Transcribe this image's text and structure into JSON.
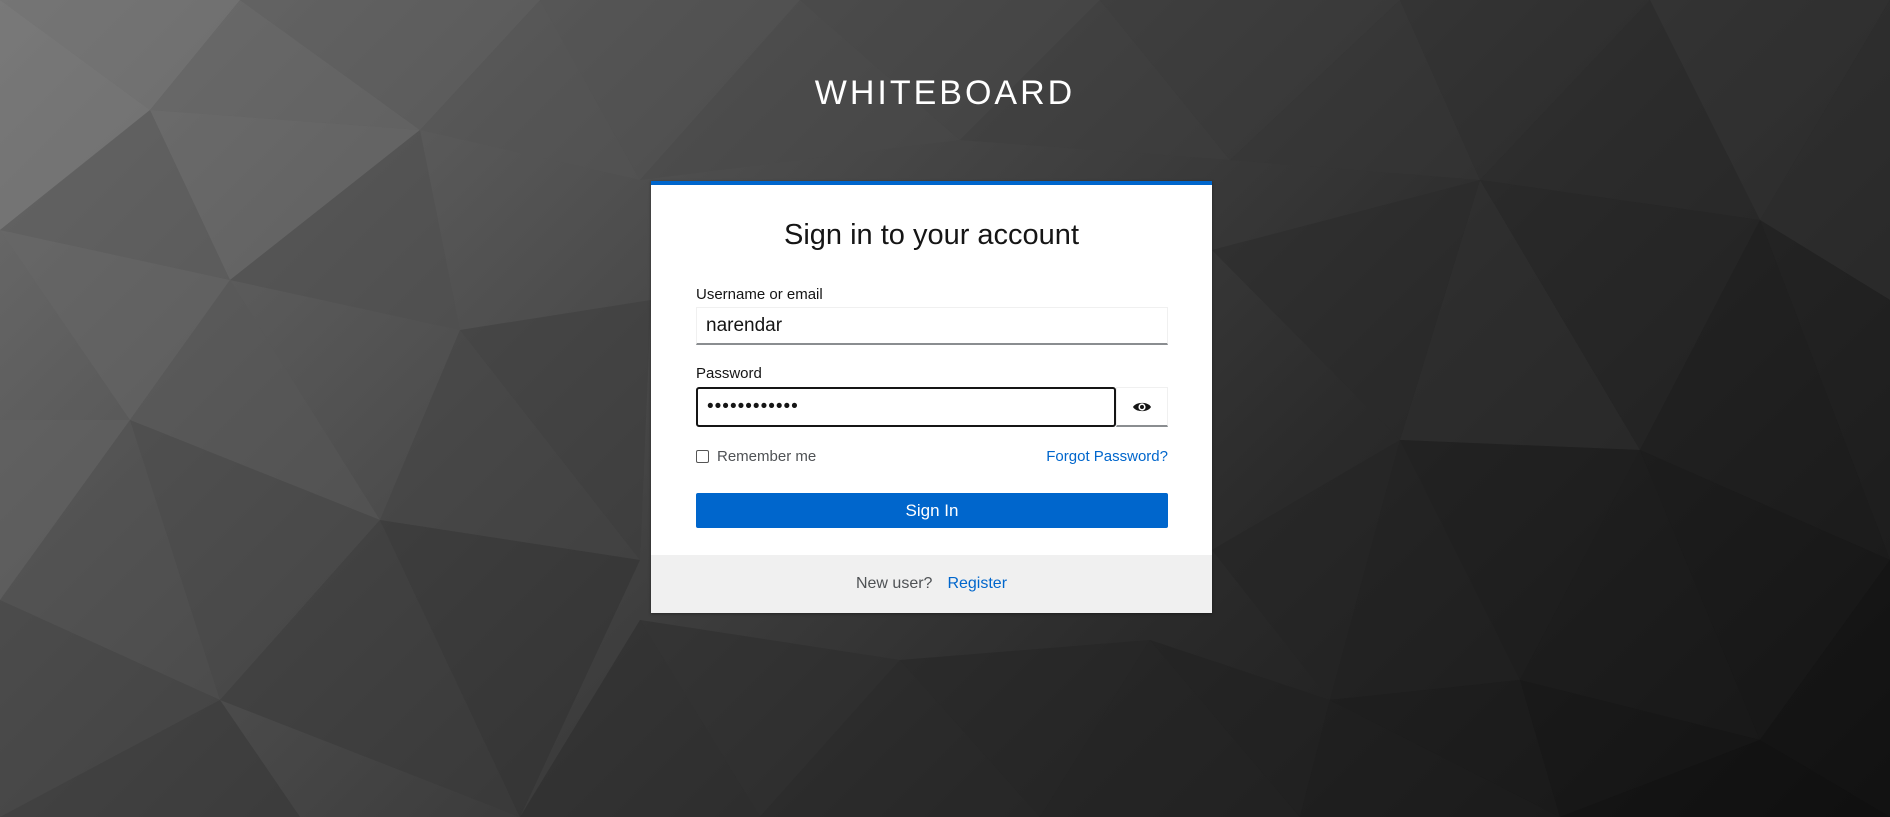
{
  "brand": {
    "title": "WHITEBOARD"
  },
  "login": {
    "heading": "Sign in to your account",
    "username_label": "Username or email",
    "username_value": "narendar",
    "password_label": "Password",
    "password_value": "••••••••••••",
    "show_password_icon": "eye-icon",
    "remember_label": "Remember me",
    "remember_checked": false,
    "forgot_label": "Forgot Password?",
    "submit_label": "Sign In"
  },
  "footer": {
    "new_user_text": "New user?",
    "register_label": "Register"
  },
  "colors": {
    "accent": "#0066cc",
    "footer_bg": "#f0f0f0",
    "card_bg": "#ffffff"
  }
}
